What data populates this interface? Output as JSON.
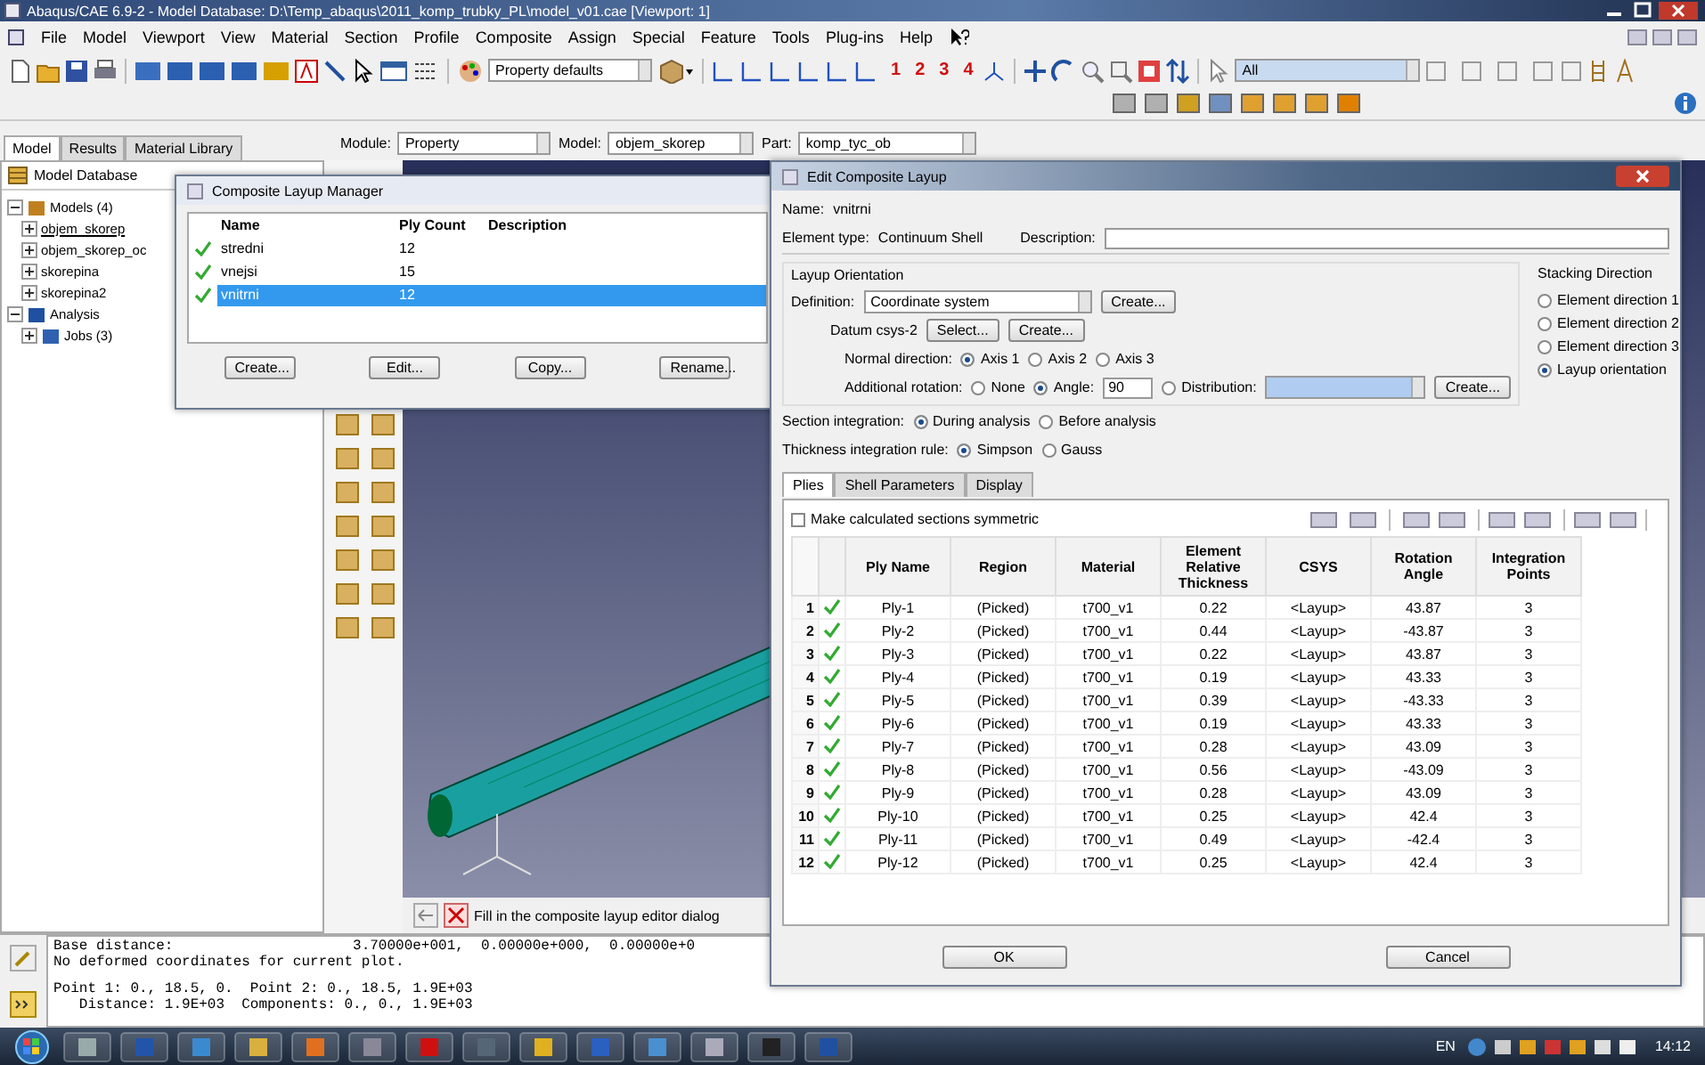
{
  "window": {
    "title": "Abaqus/CAE 6.9-2 - Model Database: D:\\Temp_abaqus\\2011_komp_trubky_PL\\model_v01.cae [Viewport: 1]"
  },
  "menu": [
    "File",
    "Model",
    "Viewport",
    "View",
    "Material",
    "Section",
    "Profile",
    "Composite",
    "Assign",
    "Special",
    "Feature",
    "Tools",
    "Plug-ins",
    "Help"
  ],
  "toolbar": {
    "render_style": "Property defaults",
    "view_numbers": [
      "1",
      "2",
      "3",
      "4"
    ],
    "selection_filter": "All"
  },
  "tree_tabs": [
    {
      "label": "Model",
      "selected": true
    },
    {
      "label": "Results",
      "selected": false
    },
    {
      "label": "Material Library",
      "selected": false
    }
  ],
  "context": {
    "module_label": "Module:",
    "module": "Property",
    "model_label": "Model:",
    "model": "objem_skorep",
    "part_label": "Part:",
    "part": "komp_tyc_ob"
  },
  "tree": {
    "root": "Model Database",
    "items": [
      {
        "label": "Models (4)",
        "kind": "models",
        "expanded": true,
        "children": [
          {
            "label": "objem_skorep",
            "kind": "model",
            "expanded": false,
            "current": true
          },
          {
            "label": "objem_skorep_oc",
            "kind": "model",
            "expanded": false,
            "current": false
          },
          {
            "label": "skorepina",
            "kind": "model",
            "expanded": false,
            "current": false
          },
          {
            "label": "skorepina2",
            "kind": "model",
            "expanded": false,
            "current": false
          }
        ]
      },
      {
        "label": "Analysis",
        "kind": "analysis",
        "expanded": true,
        "children": [
          {
            "label": "Jobs (3)",
            "kind": "jobs",
            "expanded": false,
            "current": false
          }
        ]
      }
    ]
  },
  "layup_manager": {
    "title": "Composite Layup Manager",
    "columns": [
      "Name",
      "Ply Count",
      "Description"
    ],
    "rows": [
      {
        "name": "stredni",
        "ply_count": "12",
        "valid": true,
        "selected": false
      },
      {
        "name": "vnejsi",
        "ply_count": "15",
        "valid": true,
        "selected": false
      },
      {
        "name": "vnitrni",
        "ply_count": "12",
        "valid": true,
        "selected": true
      }
    ],
    "buttons": [
      "Create...",
      "Edit...",
      "Copy...",
      "Rename..."
    ]
  },
  "prompt": {
    "text": "Fill in the composite layup editor dialog"
  },
  "console": {
    "blocks": [
      [
        "Base distance:                     3.70000e+001,  0.00000e+000,  0.00000e+0",
        "No deformed coordinates for current plot."
      ],
      [
        "Point 1: 0., 18.5, 0.  Point 2: 0., 18.5, 1.9E+03",
        "   Distance: 1.9E+03  Components: 0., 0., 1.9E+03"
      ]
    ]
  },
  "layup_editor": {
    "title": "Edit Composite Layup",
    "name_label": "Name:",
    "name": "vnitrni",
    "element_type_label": "Element type:",
    "element_type": "Continuum Shell",
    "description_label": "Description:",
    "orientation": {
      "title": "Layup Orientation",
      "definition_label": "Definition:",
      "definition": "Coordinate system",
      "create_label": "Create...",
      "datum": "Datum csys-2",
      "datum_buttons": [
        "Select...",
        "Create..."
      ],
      "normal_direction": {
        "label": "Normal direction:",
        "options": [
          {
            "label": "Axis 1",
            "selected": true
          },
          {
            "label": "Axis 2",
            "selected": false
          },
          {
            "label": "Axis 3",
            "selected": false
          }
        ]
      },
      "additional_rotation": {
        "label": "Additional rotation:",
        "options": [
          {
            "label": "None",
            "selected": false
          },
          {
            "label": "Angle:",
            "selected": true
          },
          {
            "label": "Distribution:",
            "selected": false
          }
        ],
        "angle": "90",
        "create_label": "Create..."
      }
    },
    "stacking_direction": {
      "title": "Stacking Direction",
      "options": [
        {
          "label": "Element direction 1",
          "selected": false
        },
        {
          "label": "Element direction 2",
          "selected": false
        },
        {
          "label": "Element direction 3",
          "selected": false
        },
        {
          "label": "Layup orientation",
          "selected": true
        }
      ]
    },
    "section_integration": {
      "label": "Section integration:",
      "options": [
        {
          "label": "During analysis",
          "selected": true
        },
        {
          "label": "Before analysis",
          "selected": false
        }
      ]
    },
    "thickness_integration": {
      "label": "Thickness integration rule:",
      "options": [
        {
          "label": "Simpson",
          "selected": true
        },
        {
          "label": "Gauss",
          "selected": false
        }
      ]
    },
    "tabs": [
      {
        "label": "Plies",
        "selected": true
      },
      {
        "label": "Shell Parameters",
        "selected": false
      },
      {
        "label": "Display",
        "selected": false
      }
    ],
    "symmetric": {
      "label": "Make calculated sections symmetric",
      "checked": false
    },
    "plies": {
      "columns": [
        "Ply Name",
        "Region",
        "Material",
        "Element Relative Thickness",
        "CSYS",
        "Rotation Angle",
        "Integration Points"
      ],
      "rows": [
        {
          "index": "1",
          "valid": true,
          "name": "Ply-1",
          "region": "(Picked)",
          "material": "t700_v1",
          "thickness": "0.22",
          "csys": "<Layup>",
          "angle": "43.87",
          "points": "3"
        },
        {
          "index": "2",
          "valid": true,
          "name": "Ply-2",
          "region": "(Picked)",
          "material": "t700_v1",
          "thickness": "0.44",
          "csys": "<Layup>",
          "angle": "-43.87",
          "points": "3"
        },
        {
          "index": "3",
          "valid": true,
          "name": "Ply-3",
          "region": "(Picked)",
          "material": "t700_v1",
          "thickness": "0.22",
          "csys": "<Layup>",
          "angle": "43.87",
          "points": "3"
        },
        {
          "index": "4",
          "valid": true,
          "name": "Ply-4",
          "region": "(Picked)",
          "material": "t700_v1",
          "thickness": "0.19",
          "csys": "<Layup>",
          "angle": "43.33",
          "points": "3"
        },
        {
          "index": "5",
          "valid": true,
          "name": "Ply-5",
          "region": "(Picked)",
          "material": "t700_v1",
          "thickness": "0.39",
          "csys": "<Layup>",
          "angle": "-43.33",
          "points": "3"
        },
        {
          "index": "6",
          "valid": true,
          "name": "Ply-6",
          "region": "(Picked)",
          "material": "t700_v1",
          "thickness": "0.19",
          "csys": "<Layup>",
          "angle": "43.33",
          "points": "3"
        },
        {
          "index": "7",
          "valid": true,
          "name": "Ply-7",
          "region": "(Picked)",
          "material": "t700_v1",
          "thickness": "0.28",
          "csys": "<Layup>",
          "angle": "43.09",
          "points": "3"
        },
        {
          "index": "8",
          "valid": true,
          "name": "Ply-8",
          "region": "(Picked)",
          "material": "t700_v1",
          "thickness": "0.56",
          "csys": "<Layup>",
          "angle": "-43.09",
          "points": "3"
        },
        {
          "index": "9",
          "valid": true,
          "name": "Ply-9",
          "region": "(Picked)",
          "material": "t700_v1",
          "thickness": "0.28",
          "csys": "<Layup>",
          "angle": "43.09",
          "points": "3"
        },
        {
          "index": "10",
          "valid": true,
          "name": "Ply-10",
          "region": "(Picked)",
          "material": "t700_v1",
          "thickness": "0.25",
          "csys": "<Layup>",
          "angle": "42.4",
          "points": "3"
        },
        {
          "index": "11",
          "valid": true,
          "name": "Ply-11",
          "region": "(Picked)",
          "material": "t700_v1",
          "thickness": "0.49",
          "csys": "<Layup>",
          "angle": "-42.4",
          "points": "3"
        },
        {
          "index": "12",
          "valid": true,
          "name": "Ply-12",
          "region": "(Picked)",
          "material": "t700_v1",
          "thickness": "0.25",
          "csys": "<Layup>",
          "angle": "42.4",
          "points": "3"
        }
      ]
    },
    "buttons": [
      "OK",
      "Cancel"
    ]
  },
  "taskbar": {
    "language": "EN",
    "time": "14:12"
  }
}
